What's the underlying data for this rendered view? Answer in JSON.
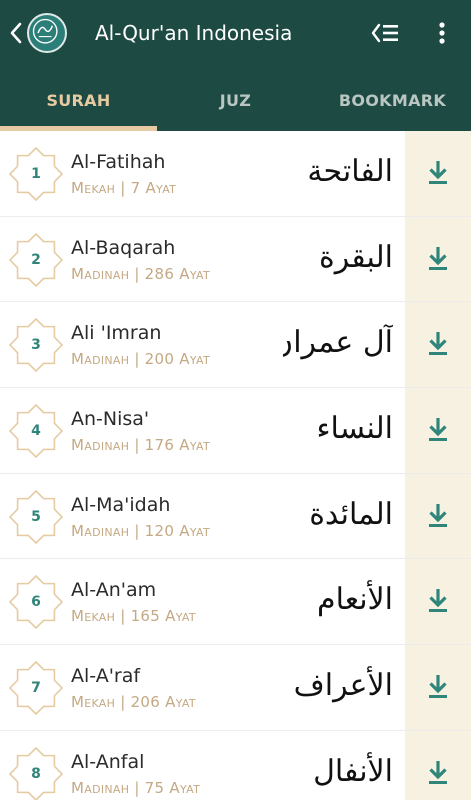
{
  "header": {
    "title": "Al-Qur'an Indonesia",
    "icons": {
      "back": "chevron-left-icon",
      "logo": "quran-logo",
      "list": "list-icon",
      "more": "more-vert-icon"
    }
  },
  "tabs": [
    {
      "label": "SURAH",
      "active": true
    },
    {
      "label": "JUZ",
      "active": false
    },
    {
      "label": "BOOKMARK",
      "active": false
    }
  ],
  "surahs": [
    {
      "number": "1",
      "name": "Al-Fatihah",
      "place": "Mekah",
      "ayat": "7 Ayat",
      "arabic": "الفاتحة"
    },
    {
      "number": "2",
      "name": "Al-Baqarah",
      "place": "Madinah",
      "ayat": "286 Ayat",
      "arabic": "البقرة"
    },
    {
      "number": "3",
      "name": "Ali 'Imran",
      "place": "Madinah",
      "ayat": "200 Ayat",
      "arabic": "آل عمران"
    },
    {
      "number": "4",
      "name": "An-Nisa'",
      "place": "Madinah",
      "ayat": "176 Ayat",
      "arabic": "النساء"
    },
    {
      "number": "5",
      "name": "Al-Ma'idah",
      "place": "Madinah",
      "ayat": "120 Ayat",
      "arabic": "المائدة"
    },
    {
      "number": "6",
      "name": "Al-An'am",
      "place": "Mekah",
      "ayat": "165 Ayat",
      "arabic": "الأنعام"
    },
    {
      "number": "7",
      "name": "Al-A'raf",
      "place": "Mekah",
      "ayat": "206 Ayat",
      "arabic": "الأعراف"
    },
    {
      "number": "8",
      "name": "Al-Anfal",
      "place": "Madinah",
      "ayat": "75 Ayat",
      "arabic": "الأنفال"
    }
  ],
  "colors": {
    "appbar": "#1e4a44",
    "accent": "#e6cba2",
    "number": "#2f857a",
    "meta": "#c4a983",
    "download": "#2f857a",
    "download_bg": "#f6f1e1"
  }
}
